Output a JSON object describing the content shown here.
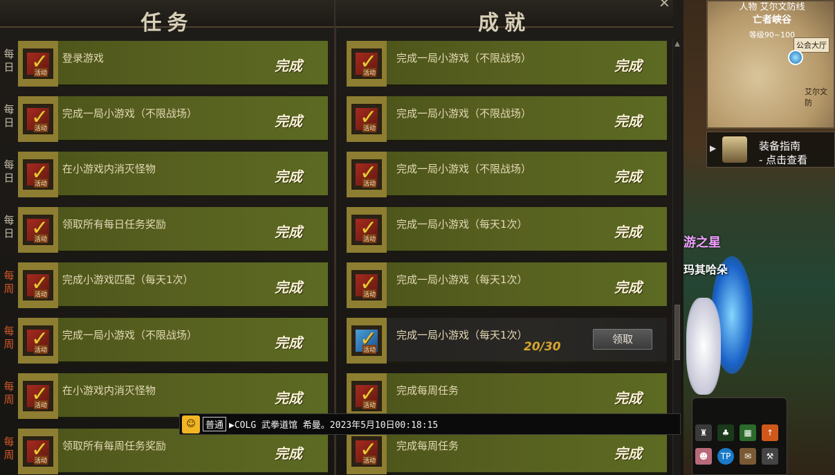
{
  "headers": {
    "left": "任务",
    "right": "成就"
  },
  "close_glyph": "✕",
  "left_rows": [
    {
      "type": "每日",
      "weekly": false,
      "title": "登录游戏",
      "status": "完成",
      "icon_tag": "活动"
    },
    {
      "type": "每日",
      "weekly": false,
      "title": "完成一局小游戏（不限战场）",
      "status": "完成",
      "icon_tag": "活动"
    },
    {
      "type": "每日",
      "weekly": false,
      "title": "在小游戏内消灭怪物",
      "status": "完成",
      "icon_tag": "活动"
    },
    {
      "type": "每日",
      "weekly": false,
      "title": "领取所有每日任务奖励",
      "status": "完成",
      "icon_tag": "活动"
    },
    {
      "type": "每周",
      "weekly": true,
      "title": "完成小游戏匹配（每天1次）",
      "status": "完成",
      "icon_tag": "活动"
    },
    {
      "type": "每周",
      "weekly": true,
      "title": "完成一局小游戏（不限战场）",
      "status": "完成",
      "icon_tag": "活动"
    },
    {
      "type": "每周",
      "weekly": true,
      "title": "在小游戏内消灭怪物",
      "status": "完成",
      "icon_tag": "活动"
    },
    {
      "type": "每周",
      "weekly": true,
      "title": "领取所有每周任务奖励",
      "status": "完成",
      "icon_tag": "活动"
    }
  ],
  "right_rows": [
    {
      "title": "完成一局小游戏（不限战场）",
      "status": "完成",
      "icon_tag": "活动"
    },
    {
      "title": "完成一局小游戏（不限战场）",
      "status": "完成",
      "icon_tag": "活动"
    },
    {
      "title": "完成一局小游戏（不限战场）",
      "status": "完成",
      "icon_tag": "活动"
    },
    {
      "title": "完成一局小游戏（每天1次）",
      "status": "完成",
      "icon_tag": "活动"
    },
    {
      "title": "完成一局小游戏（每天1次）",
      "status": "完成",
      "icon_tag": "活动"
    },
    {
      "title": "完成一局小游戏（每天1次）",
      "status": "",
      "progress": "20/30",
      "claim_label": "领取",
      "pending": true,
      "icon_tag": "活动"
    },
    {
      "title": "完成每周任务",
      "status": "完成",
      "icon_tag": "活动"
    },
    {
      "title": "完成每周任务",
      "status": "完成",
      "icon_tag": "活动"
    }
  ],
  "chat": {
    "channel": "普通",
    "message": "▶COLG 武拳道馆 希曼。2023年5月10日00:18:15"
  },
  "game": {
    "minimap_place": "人物  艾尔文防线",
    "minimap_zone": "亡者峡谷",
    "minimap_level": "等级90~100",
    "minimap_guild": "公会大厅",
    "minimap_town": "艾尔文防",
    "guide_line1": "装备指南",
    "guide_line2": "- 点击查看",
    "title_text": "游之星",
    "char_name": "玛其哈朵"
  },
  "colors": {
    "done_bar": "#586120",
    "icon_frame": "#8d7e32",
    "weekly_label": "#d25a2a",
    "progress": "#d6a62e"
  }
}
